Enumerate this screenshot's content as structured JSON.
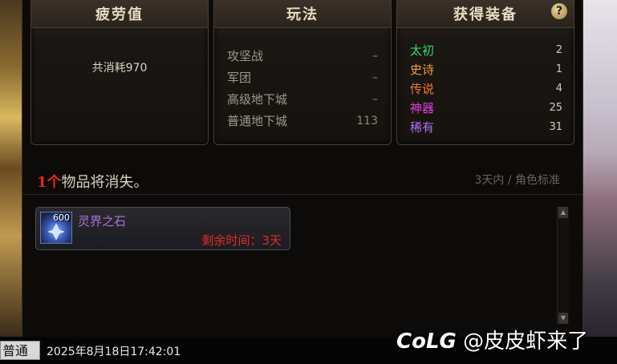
{
  "panels": {
    "fatigue": {
      "title": "疲劳值",
      "consumed": "共消耗970"
    },
    "modes": {
      "title": "玩法",
      "rows": [
        {
          "name": "攻坚战",
          "value": "–"
        },
        {
          "name": "军团",
          "value": "–"
        },
        {
          "name": "高级地下城",
          "value": "–"
        },
        {
          "name": "普通地下城",
          "value": "113"
        }
      ]
    },
    "loot": {
      "title": "获得装备",
      "help_label": "?",
      "rows": [
        {
          "name": "太初",
          "value": "2",
          "color": "#34d86a"
        },
        {
          "name": "史诗",
          "value": "1",
          "color": "#f0a030"
        },
        {
          "name": "传说",
          "value": "4",
          "color": "#f07a28"
        },
        {
          "name": "神器",
          "value": "25",
          "color": "#e040e0"
        },
        {
          "name": "稀有",
          "value": "31",
          "color": "#b070f0"
        }
      ]
    }
  },
  "vanish": {
    "count": "1个",
    "title_rest": "物品将消失。",
    "note": "3天内 / 角色标准"
  },
  "item": {
    "quantity": "600",
    "name": "灵界之石",
    "remaining": "剩余时间：3天"
  },
  "footer": {
    "mode_tag": "普通",
    "timestamp": "2025年8月18日17:42:01"
  },
  "watermark": {
    "logo": "CoLG",
    "text": "@皮皮虾来了"
  }
}
